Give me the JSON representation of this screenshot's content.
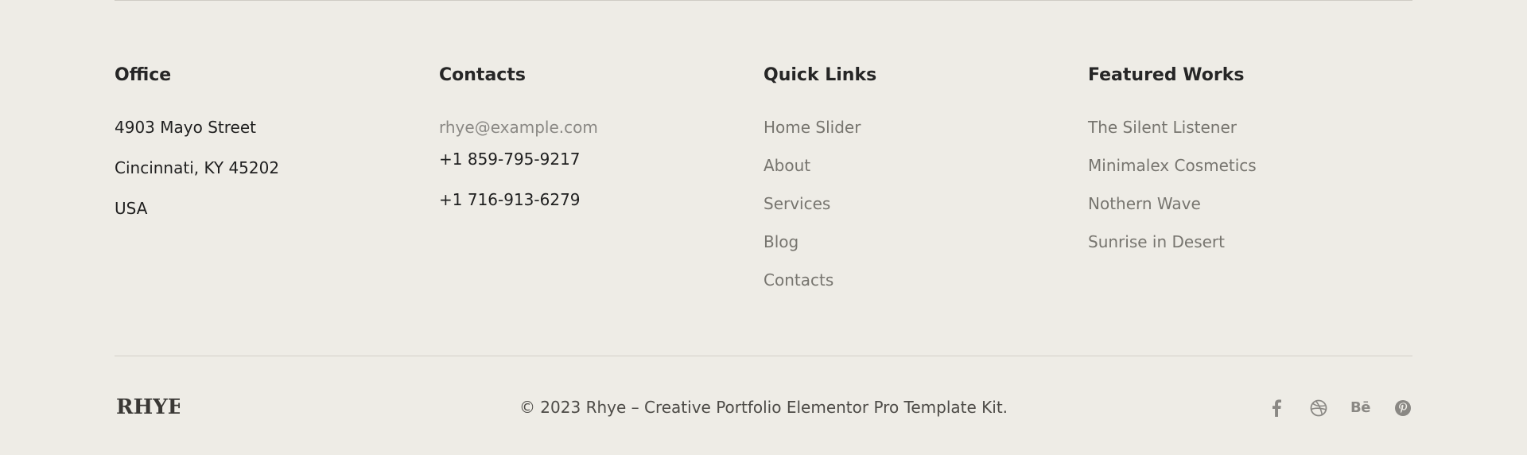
{
  "office": {
    "heading": "Office",
    "lines": [
      "4903 Mayo Street",
      "Cincinnati, KY 45202",
      "USA"
    ]
  },
  "contacts": {
    "heading": "Contacts",
    "email": "rhye@example.com",
    "phones": [
      "+1 859-795-9217",
      "+1 716-913-6279"
    ]
  },
  "quick_links": {
    "heading": "Quick Links",
    "items": [
      "Home Slider",
      "About",
      "Services",
      "Blog",
      "Contacts"
    ]
  },
  "featured_works": {
    "heading": "Featured Works",
    "items": [
      "The Silent Listener",
      "Minimalex Cosmetics",
      "Nothern Wave",
      "Sunrise in Desert"
    ]
  },
  "bottom": {
    "logo_text": "RHYE",
    "copyright": "© 2023 Rhye – Creative Portfolio Elementor Pro Template Kit.",
    "socials": [
      {
        "name": "facebook-icon"
      },
      {
        "name": "dribbble-icon"
      },
      {
        "name": "behance-icon",
        "label": "Bē"
      },
      {
        "name": "pinterest-icon"
      }
    ]
  },
  "colors": {
    "background": "#eeece6",
    "heading": "#262626",
    "link": "#77756f",
    "muted": "#8a8884"
  }
}
